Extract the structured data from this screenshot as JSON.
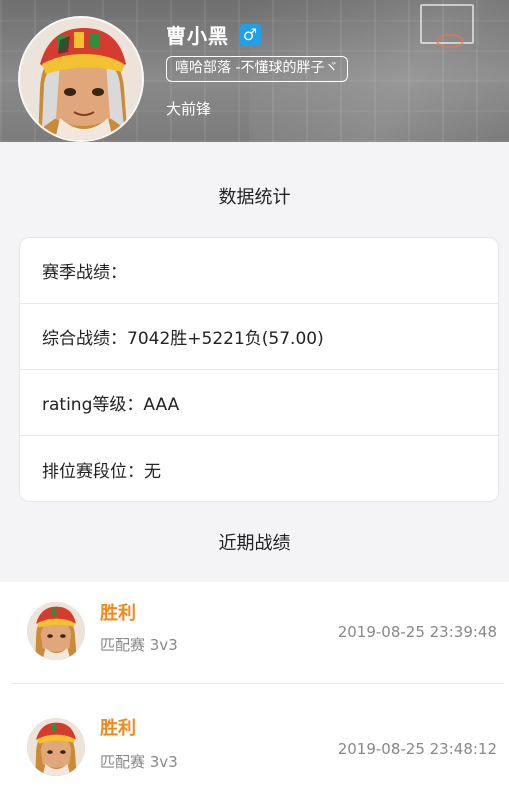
{
  "profile": {
    "name": "曹小黑",
    "gender_symbol": "♂",
    "clan": "嘻哈部落 -不懂球的胖子ヾ",
    "position": "大前锋"
  },
  "stats_section": {
    "title": "数据统计",
    "rows": [
      "赛季战绩：",
      "综合战绩：7042胜+5221负(57.00)",
      "rating等级：AAA",
      "排位赛段位：无"
    ]
  },
  "recent_section": {
    "title": "近期战绩",
    "matches": [
      {
        "result": "胜利",
        "type": "匹配赛 3v3",
        "time": "2019-08-25 23:39:48"
      },
      {
        "result": "胜利",
        "type": "匹配赛 3v3",
        "time": "2019-08-25 23:48:12"
      }
    ]
  },
  "colors": {
    "accent_win": "#f08a1e",
    "gender_badge": "#1fa0e8"
  }
}
